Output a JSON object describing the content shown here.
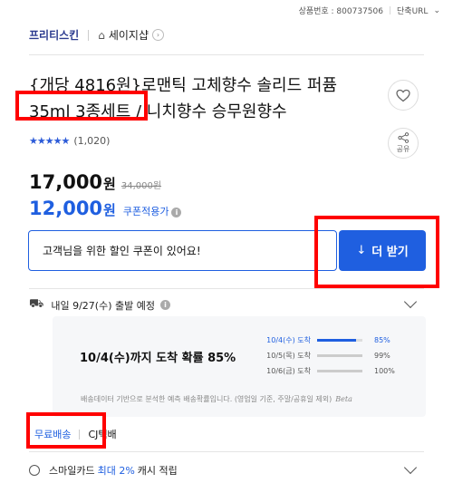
{
  "meta": {
    "product_no_label": "상품번호 : 800737506",
    "shorten_url_label": "단축URL"
  },
  "breadcrumb": {
    "shop": "프리티스킨",
    "store": "세이지샵"
  },
  "product": {
    "title": "{개당 4816원}로맨틱 고체향수 솔리드 퍼퓸 35ml 3종세트 / 니치향수 승무원향수",
    "rating_count": "(1,020)",
    "rating_value": 4.5,
    "share_label": "공유"
  },
  "price": {
    "sale": "17,000",
    "won": "원",
    "original": "34,000원",
    "coupon_price": "12,000",
    "coupon_label": "쿠폰적용가"
  },
  "coupon": {
    "message": "고객님을 위한 할인 쿠폰이 있어요!",
    "button": "더 받기"
  },
  "shipping": {
    "summary": "내일 9/27(수) 출발 예정",
    "forecast_title": "10/4(수)까지 도착 확률 85%",
    "forecast": [
      {
        "date": "10/4(수) 도착",
        "pct": "85%",
        "value": 0.85,
        "highlight": true
      },
      {
        "date": "10/5(목) 도착",
        "pct": "99%",
        "value": 0.99,
        "highlight": false
      },
      {
        "date": "10/6(금) 도착",
        "pct": "100%",
        "value": 1.0,
        "highlight": false
      }
    ],
    "note": "배송데이터 기반으로 분석한 예측 배송확률입니다. (영업일 기준, 주말/공휴일 제외)",
    "beta": "Beta",
    "free_shipping": "무료배송",
    "courier": "CJ택배"
  },
  "smilecard": {
    "prefix": "스마일카드",
    "highlight": "최대 2%",
    "suffix": "캐시 적립"
  }
}
